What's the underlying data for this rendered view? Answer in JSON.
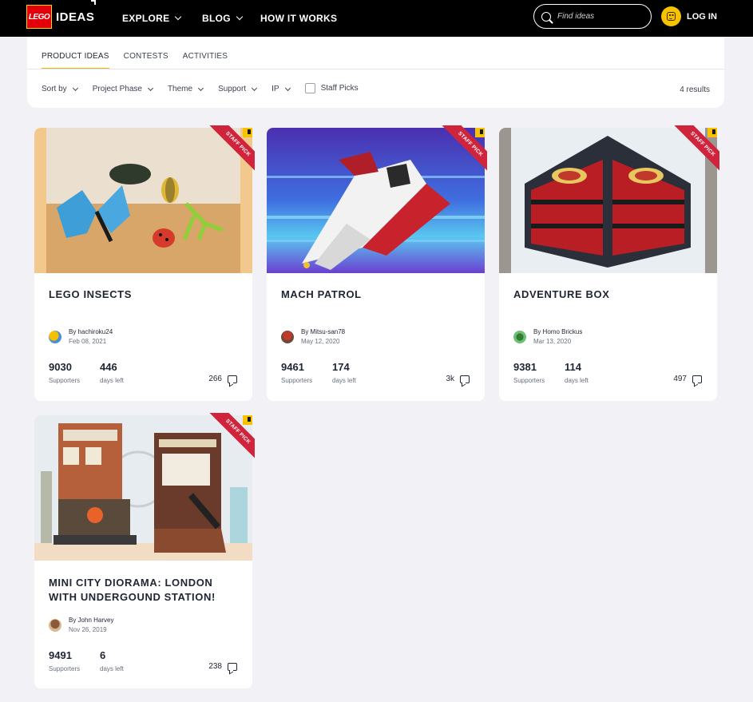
{
  "header": {
    "logo_text": "LEGO",
    "logo_ideas": "IDEAS",
    "nav": [
      "EXPLORE",
      "BLOG",
      "HOW IT WORKS"
    ],
    "search_placeholder": "Find ideas",
    "login_label": "LOG IN"
  },
  "tabs": [
    "PRODUCT IDEAS",
    "CONTESTS",
    "ACTIVITIES"
  ],
  "filters": [
    "Sort by",
    "Project Phase",
    "Theme",
    "Support",
    "IP"
  ],
  "staff_picks_label": "Staff Picks",
  "results_label": "4 results",
  "badge_text": "STAFF PICK",
  "cards": [
    {
      "title": "LEGO INSECTS",
      "author": "By hachiroku24",
      "date": "Feb 08, 2021",
      "supporters": "9030",
      "supporters_label": "Supporters",
      "days": "446",
      "days_label": "days left",
      "comments": "266"
    },
    {
      "title": "MACH PATROL",
      "author": "By Mitsu-san78",
      "date": "May 12, 2020",
      "supporters": "9461",
      "supporters_label": "Supporters",
      "days": "174",
      "days_label": "days left",
      "comments": "3k"
    },
    {
      "title": "ADVENTURE BOX",
      "author": "By Homo Brickus",
      "date": "Mar 13, 2020",
      "supporters": "9381",
      "supporters_label": "Supporters",
      "days": "114",
      "days_label": "days left",
      "comments": "497"
    },
    {
      "title": "MINI CITY DIORAMA: LONDON WITH UNDERGOUND STATION!",
      "author": "By John Harvey",
      "date": "Nov 26, 2019",
      "supporters": "9491",
      "supporters_label": "Supporters",
      "days": "6",
      "days_label": "days left",
      "comments": "238"
    }
  ]
}
